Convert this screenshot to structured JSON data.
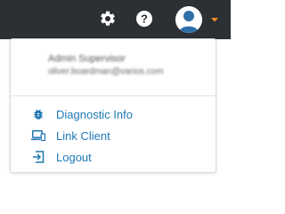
{
  "topbar": {
    "background": "#2c2f33",
    "icons": [
      "gear-icon",
      "help-icon",
      "user-avatar",
      "caret-down-icon"
    ],
    "caret_color": "#f28c28"
  },
  "user": {
    "name": "Admin Supervisor",
    "email": "oliver.boardman@varios.com"
  },
  "menu": {
    "accent_color": "#1f78b4",
    "items": [
      {
        "label": "Diagnostic Info",
        "icon": "bug-icon"
      },
      {
        "label": "Link Client",
        "icon": "devices-icon"
      },
      {
        "label": "Logout",
        "icon": "logout-icon"
      }
    ]
  }
}
